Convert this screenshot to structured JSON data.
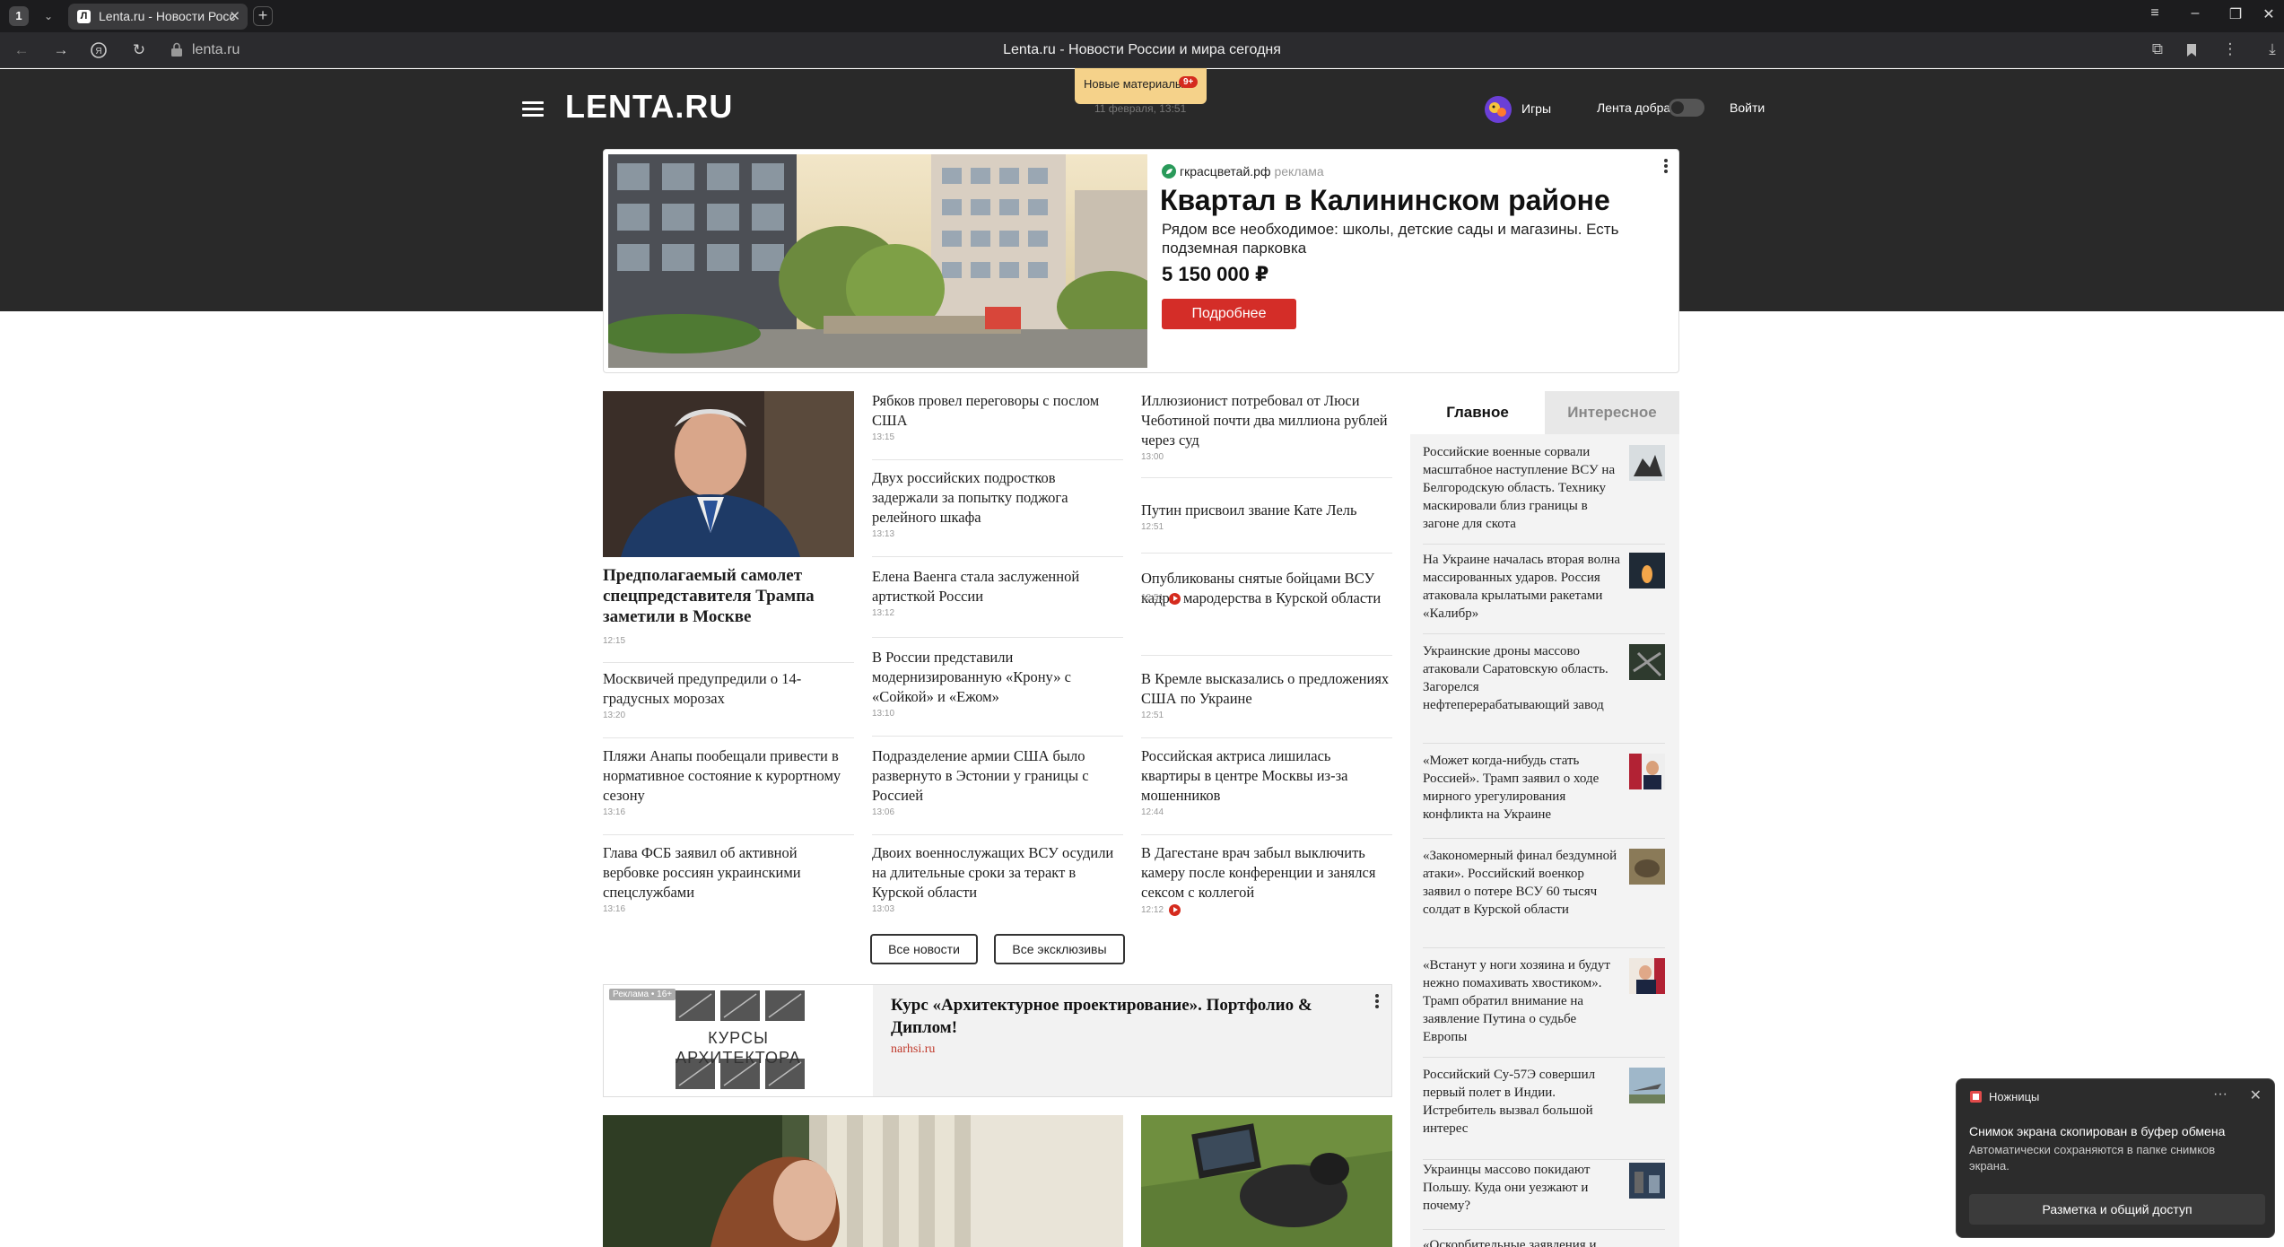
{
  "browser": {
    "tab_count": "1",
    "tab_title": "Lenta.ru - Новости Росс",
    "tab_favicon": "Л",
    "url": "lenta.ru",
    "page_title": "Lenta.ru - Новости России и мира сегодня"
  },
  "header": {
    "logo": "LENTA.RU",
    "new_materials": "Новые материалы",
    "new_count": "9+",
    "date": "11 февраля, 13:51",
    "games": "Игры",
    "lenta_dobra": "Лента добра",
    "login": "Войти"
  },
  "banner_ad": {
    "source": "гкрасцветай.рф",
    "ad_label": "реклама",
    "title": "Квартал в Калининском районе",
    "description": "Рядом все необходимое: школы, детские сады и магазины. Есть подземная парковка",
    "price": "5 150 000 ₽",
    "button": "Подробнее"
  },
  "featured": {
    "title": "Предполагаемый самолет спецпредставителя Трампа заметили в Москве",
    "time": "12:15"
  },
  "col1": [
    {
      "title": "Москвичей предупредили о 14-градусных морозах",
      "time": "13:20"
    },
    {
      "title": "Пляжи Анапы пообещали привести в нормативное состояние к курортному сезону",
      "time": "13:16"
    },
    {
      "title": "Глава ФСБ заявил об активной вербовке россиян украинскими спецслужбами",
      "time": "13:16"
    }
  ],
  "col2": [
    {
      "title": "Рябков провел переговоры с послом США",
      "time": "13:15"
    },
    {
      "title": "Двух российских подростков задержали за попытку поджога релейного шкафа",
      "time": "13:13"
    },
    {
      "title": "Елена Ваенга стала заслуженной артисткой России",
      "time": "13:12"
    },
    {
      "title": "В России представили модернизированную «Крону» с «Сойкой» и «Ежом»",
      "time": "13:10"
    },
    {
      "title": "Подразделение армии США было развернуто в Эстонии у границы с Россией",
      "time": "13:06"
    },
    {
      "title": "Двоих военнослужащих ВСУ осудили на длительные сроки за теракт в Курской области",
      "time": "13:03"
    }
  ],
  "col3": [
    {
      "title": "Иллюзионист потребовал от Люси Чеботиной почти два миллиона рублей через суд",
      "time": "13:00"
    },
    {
      "title": "Путин присвоил звание Кате Лель",
      "time": "12:51"
    },
    {
      "title": "Опубликованы снятые бойцами ВСУ кадры мародерства в Курской области",
      "time": "12:51"
    },
    {
      "title": "В Кремле высказались о предложениях США по Украине",
      "time": "12:51"
    },
    {
      "title": "Российская актриса лишилась квартиры в центре Москвы из-за мошенников",
      "time": "12:44"
    },
    {
      "title": "В Дагестане врач забыл выключить камеру после конференции и занялся сексом с коллегой",
      "time": "12:12"
    }
  ],
  "buttons": {
    "all_news": "Все новости",
    "all_exclusive": "Все эксклюзивы"
  },
  "sidebar": {
    "tab_main": "Главное",
    "tab_interesting": "Интересное",
    "items": [
      {
        "title": "Российские военные сорвали масштабное наступление ВСУ на Белгородскую область. Технику маскировали близ границы в загоне для скота"
      },
      {
        "title": "На Украине началась вторая волна массированных ударов. Россия атаковала крылатыми ракетами «Калибр»"
      },
      {
        "title": "Украинские дроны массово атаковали Саратовскую область. Загорелся нефтеперерабатывающий завод"
      },
      {
        "title": "«Может когда-нибудь стать Россией». Трамп заявил о ходе мирного урегулирования конфликта на Украине"
      },
      {
        "title": "«Закономерный финал бездумной атаки». Российский военкор заявил о потере ВСУ 60 тысяч солдат в Курской области"
      },
      {
        "title": "«Встанут у ноги хозяина и будут нежно помахивать хвостиком». Трамп обратил внимание на заявление Путина о судьбе Европы"
      },
      {
        "title": "Российский Су-57Э совершил первый полет в Индии. Истребитель вызвал большой интерес"
      },
      {
        "title": "Украинцы массово покидают Польшу. Куда они уезжают и почему?"
      },
      {
        "title": "«Оскорбительные заявления и"
      }
    ]
  },
  "bottom_ad": {
    "tag": "Реклама • 16+",
    "logo_line1": "КУРСЫ",
    "logo_line2": "АРХИТЕКТОРА",
    "title": "Курс «Архитектурное проектирование». Портфолио & Диплом!",
    "site": "narhsi.ru"
  },
  "notification": {
    "app": "Ножницы",
    "heading": "Снимок экрана скопирован в буфер обмена",
    "body": "Автоматически сохраняются в папке снимков экрана.",
    "button": "Разметка и общий доступ"
  }
}
